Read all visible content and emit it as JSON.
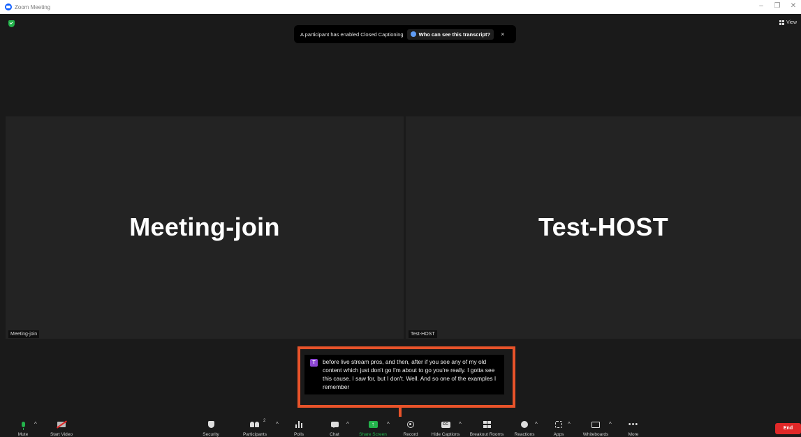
{
  "window": {
    "title": "Zoom Meeting",
    "controls": {
      "minimize": "–",
      "restore": "❐",
      "close": "✕"
    }
  },
  "banner": {
    "message": "A participant has enabled Closed Captioning",
    "link": "Who can see this transcript?",
    "close": "×"
  },
  "view_button": {
    "label": "View"
  },
  "tiles": [
    {
      "display_name": "Meeting-join",
      "tag": "Meeting-join"
    },
    {
      "display_name": "Test-HOST",
      "tag": "Test-HOST"
    }
  ],
  "caption": {
    "avatar_letter": "T",
    "text": "before live stream pros, and then, after if you see any of my old content which just don't go I'm about to go you're really. I gotta see this cause. I saw for, but I don't. Well. And so one of the examples I remember"
  },
  "toolbar": {
    "mute": "Mute",
    "start_video": "Start Video",
    "security": "Security",
    "participants": "Participants",
    "participant_count": "2",
    "polls": "Polls",
    "chat": "Chat",
    "share_screen": "Share Screen",
    "record": "Record",
    "hide_captions": "Hide Captions",
    "cc_badge": "CC",
    "breakout_rooms": "Breakout Rooms",
    "reactions": "Reactions",
    "apps": "Apps",
    "whiteboards": "Whiteboards",
    "more": "More",
    "end": "End"
  },
  "colors": {
    "accent_green": "#23b24b",
    "end_red": "#e02828",
    "highlight_orange": "#e8532a"
  }
}
